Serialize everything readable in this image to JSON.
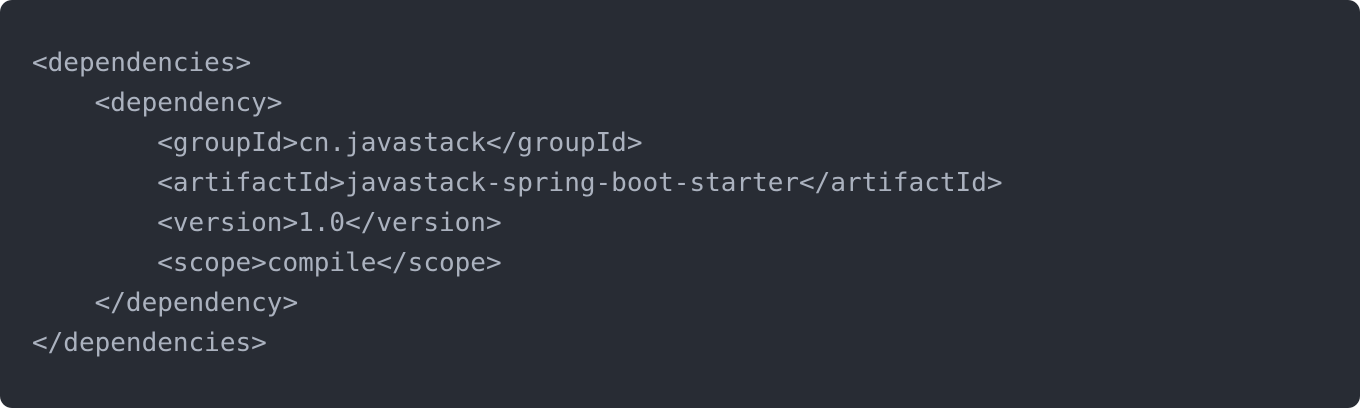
{
  "code": {
    "language": "xml",
    "lines": [
      "<dependencies>",
      "    <dependency>",
      "        <groupId>cn.javastack</groupId>",
      "        <artifactId>javastack-spring-boot-starter</artifactId>",
      "        <version>1.0</version>",
      "        <scope>compile</scope>",
      "    </dependency>",
      "</dependencies>"
    ]
  },
  "colors": {
    "background": "#282c34",
    "text": "#abb2bf"
  }
}
